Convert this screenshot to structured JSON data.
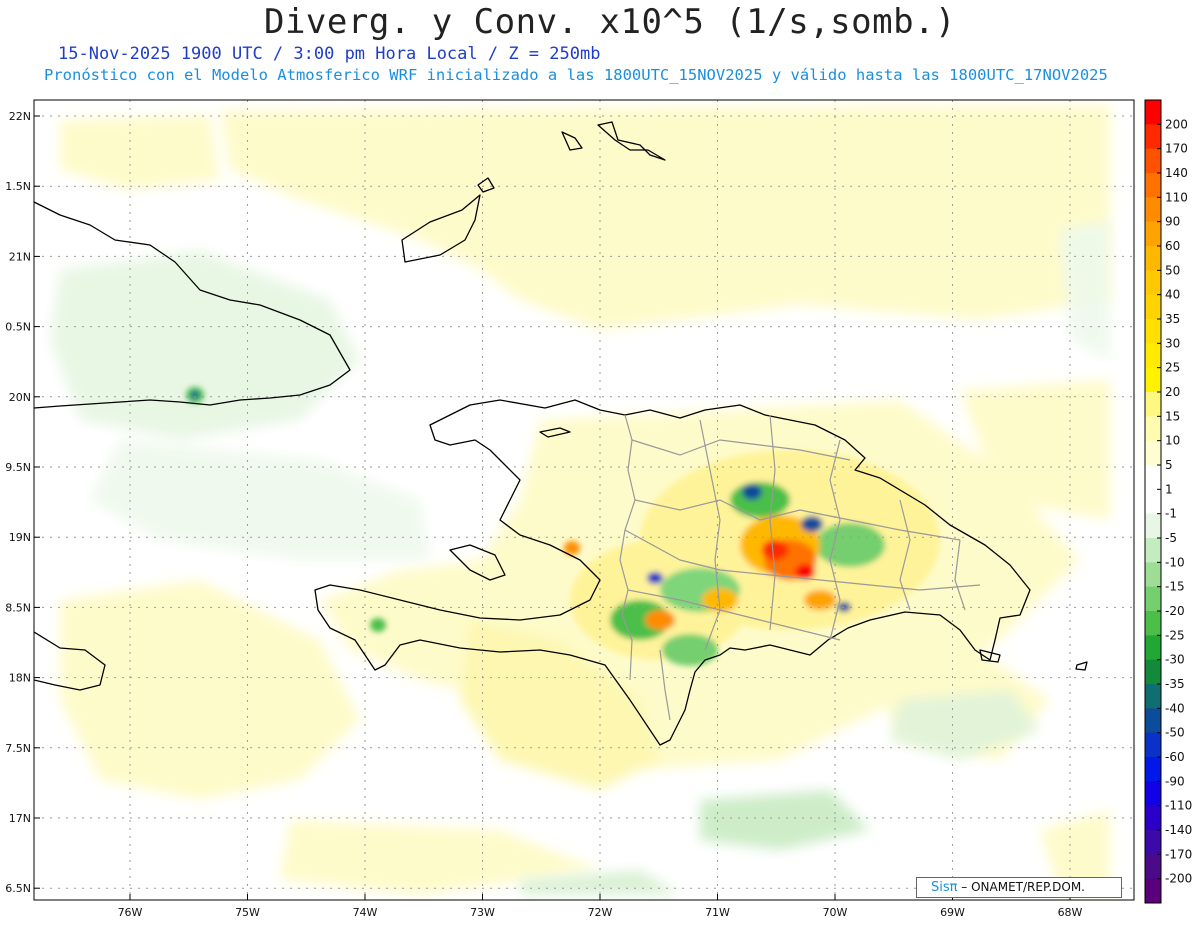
{
  "title": "Diverg. y Conv. x10^5 (1/s,somb.)",
  "subtitle_line1": "15-Nov-2025  1900 UTC / 3:00 pm Hora Local / Z = 250mb",
  "subtitle_line2": "Pronóstico con el Modelo Atmosferico WRF inicializado a las 1800UTC_15NOV2025 y válido hasta las  1800UTC_17NOV2025",
  "latitude_labels": [
    "22N",
    "1.5N",
    "21N",
    "0.5N",
    "20N",
    "9.5N",
    "19N",
    "8.5N",
    "18N",
    "7.5N",
    "17N",
    "6.5N"
  ],
  "longitude_labels": [
    "76W",
    "75W",
    "74W",
    "73W",
    "72W",
    "71W",
    "70W",
    "69W",
    "68W"
  ],
  "colorbar": {
    "labels": [
      "200",
      "170",
      "140",
      "110",
      "90",
      "60",
      "50",
      "40",
      "35",
      "30",
      "25",
      "20",
      "15",
      "10",
      "5",
      "1",
      "-1",
      "-5",
      "-10",
      "-15",
      "-20",
      "-25",
      "-30",
      "-35",
      "-40",
      "-50",
      "-60",
      "-90",
      "-110",
      "-140",
      "-170",
      "-200"
    ],
    "colors": [
      "#ff0000",
      "#ff2a00",
      "#ff5200",
      "#ff7200",
      "#ff8c00",
      "#ffa300",
      "#ffb800",
      "#ffc800",
      "#ffd400",
      "#ffe000",
      "#ffea00",
      "#fff200",
      "#fff880",
      "#fffbb0",
      "#fffdd2",
      "#ffffff",
      "#ffffff",
      "#e8f7e5",
      "#c4ecc0",
      "#9ddd96",
      "#75cf6e",
      "#4cbf4a",
      "#21a834",
      "#128a3a",
      "#0e6e70",
      "#0d4c9a",
      "#0a32c8",
      "#0018e8",
      "#1200e6",
      "#2a00c8",
      "#3b0aa8",
      "#4b0a8a",
      "#5a007a"
    ]
  },
  "credit": {
    "logo": "Sisπ",
    "text": " – ONAMET/REP.DOM."
  },
  "colors": {
    "coastline": "#000000",
    "admin_boundaries": "#999999",
    "gridlines": "#9a9a9a",
    "frame": "#000000"
  }
}
